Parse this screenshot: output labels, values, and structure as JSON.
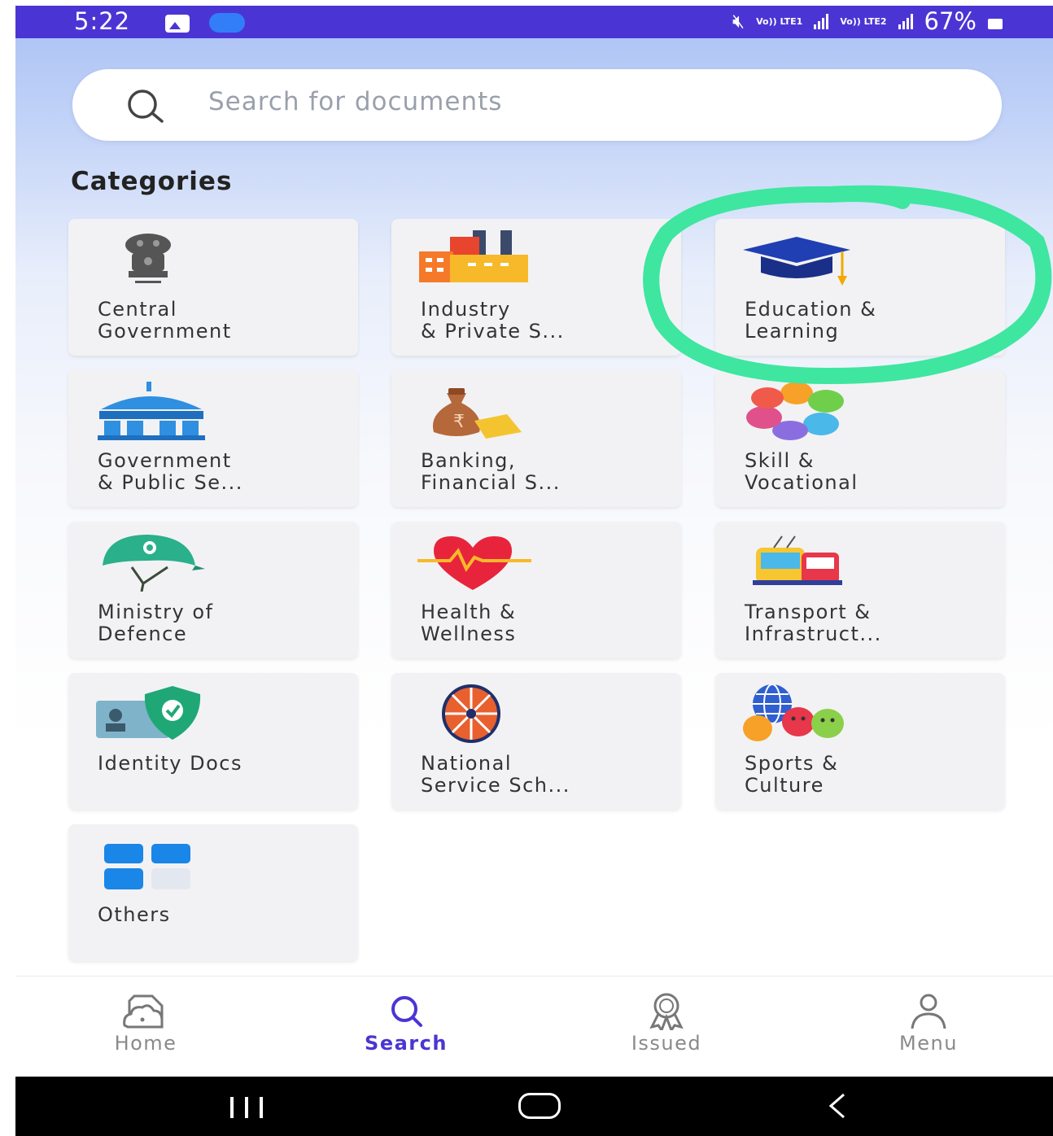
{
  "status_bar": {
    "time": "5:22",
    "network_1": "Vo)) LTE1",
    "network_2": "Vo)) LTE2",
    "battery": "67%"
  },
  "search": {
    "placeholder": "Search for documents",
    "icon": "search-icon"
  },
  "categories": {
    "title": "Categories",
    "items": [
      {
        "label": "Central\nGovernment",
        "icon": "national-emblem-icon"
      },
      {
        "label": "Industry\n& Private S...",
        "icon": "factory-icon"
      },
      {
        "label": "Education &\nLearning",
        "icon": "graduation-cap-icon"
      },
      {
        "label": "Government\n& Public Se...",
        "icon": "government-building-icon"
      },
      {
        "label": "Banking,\nFinancial S...",
        "icon": "money-bag-icon"
      },
      {
        "label": "Skill &\nVocational",
        "icon": "petals-icon"
      },
      {
        "label": "Ministry of\nDefence",
        "icon": "helmet-icon"
      },
      {
        "label": "Health &\nWellness",
        "icon": "heart-pulse-icon"
      },
      {
        "label": "Transport &\nInfrastruct...",
        "icon": "bus-icon"
      },
      {
        "label": "Identity Docs",
        "icon": "id-card-shield-icon"
      },
      {
        "label": "National\nService Sch...",
        "icon": "wheel-icon"
      },
      {
        "label": "Sports &\nCulture",
        "icon": "globe-masks-icon"
      },
      {
        "label": "Others",
        "icon": "grid-icon"
      }
    ]
  },
  "highlight": {
    "color": "#3ee6a0",
    "target": "Education & Learning"
  },
  "bottom_nav": {
    "items": [
      {
        "label": "Home",
        "icon": "home-cloud-icon",
        "active": false
      },
      {
        "label": "Search",
        "icon": "search-icon",
        "active": true
      },
      {
        "label": "Issued",
        "icon": "award-icon",
        "active": false
      },
      {
        "label": "Menu",
        "icon": "user-icon",
        "active": false
      }
    ]
  },
  "colors": {
    "accent": "#4a35d4",
    "status_bar": "#4a35d4",
    "card_bg": "#f2f2f4"
  }
}
